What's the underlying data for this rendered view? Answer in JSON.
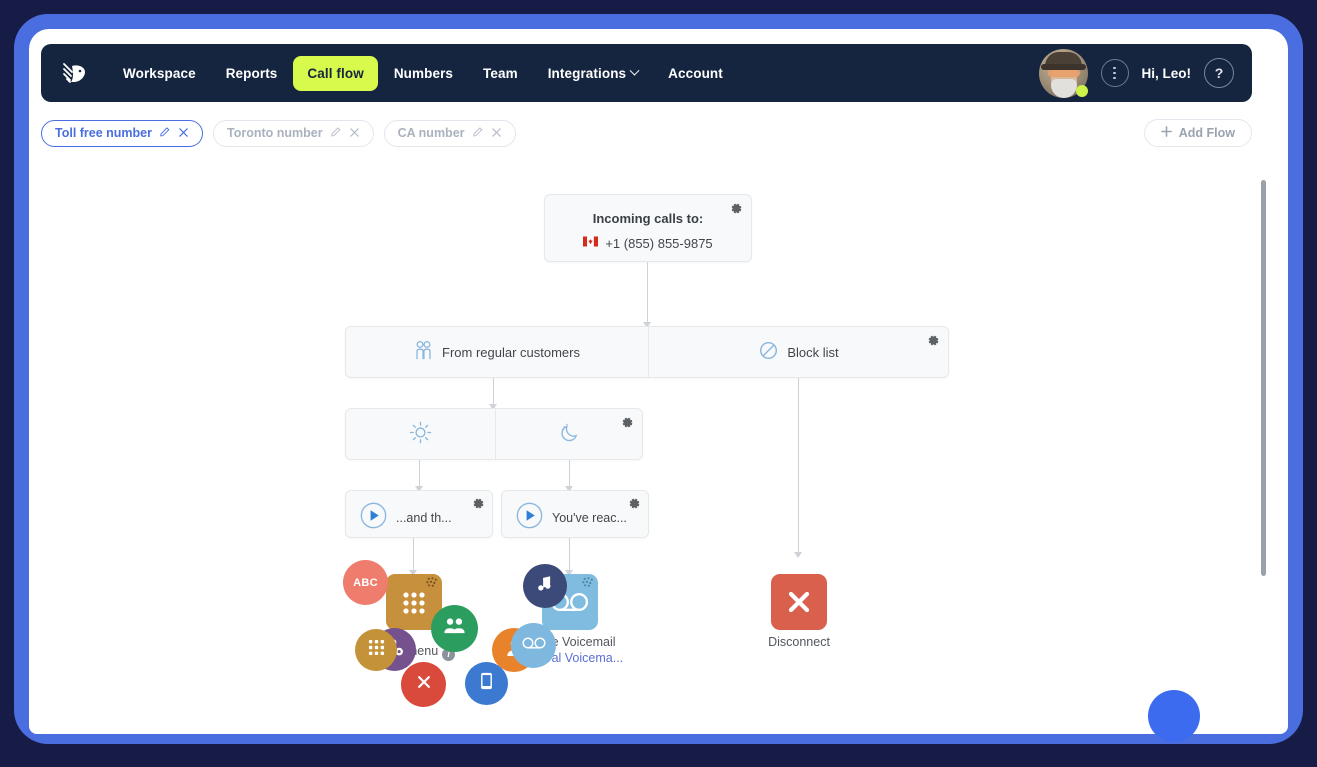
{
  "app": {
    "brand_logo": "lion-head-logo",
    "nav_bg": "#16253f",
    "accent": "#d7fa4c",
    "link_color": "#4a6ee0"
  },
  "nav": {
    "items": [
      {
        "label": "Workspace",
        "active": false,
        "dropdown": false
      },
      {
        "label": "Reports",
        "active": false,
        "dropdown": false
      },
      {
        "label": "Call flow",
        "active": true,
        "dropdown": false
      },
      {
        "label": "Numbers",
        "active": false,
        "dropdown": false
      },
      {
        "label": "Team",
        "active": false,
        "dropdown": false
      },
      {
        "label": "Integrations",
        "active": false,
        "dropdown": true
      },
      {
        "label": "Account",
        "active": false,
        "dropdown": false
      }
    ],
    "greeting": "Hi, Leo!",
    "help_label": "?",
    "more_label": "more-options",
    "status": "online"
  },
  "tabs": {
    "items": [
      {
        "label": "Toll free number",
        "active": true
      },
      {
        "label": "Toronto number",
        "active": false
      },
      {
        "label": "CA number",
        "active": false
      }
    ],
    "edit_icon": "pencil-icon",
    "close_icon": "close-icon",
    "add_flow_label": "Add Flow",
    "add_flow_icon": "plus-icon"
  },
  "flow": {
    "incoming": {
      "title": "Incoming calls to:",
      "number": "+1 (855) 855-9875",
      "flag": "🇨🇦"
    },
    "filter_row": {
      "left": {
        "label": "From regular customers",
        "icon": "two-people-icon"
      },
      "right": {
        "label": "Block list",
        "icon": "block-icon"
      }
    },
    "schedule_row": {
      "left": {
        "label": "Daytime",
        "icon": "sun-icon"
      },
      "right": {
        "label": "Night",
        "icon": "moon-icon"
      }
    },
    "greeting_nodes": {
      "left": {
        "text": "...and th...",
        "icon": "play-icon"
      },
      "right": {
        "text": "You've reac...",
        "icon": "play-icon"
      }
    },
    "leaves": {
      "voice_menu": {
        "label": "Voice menu",
        "icon": "keypad-icon",
        "info": "i"
      },
      "voicemail": {
        "label": "Leave Voicemail",
        "link": "General Voicema...",
        "icon": "voicemail-icon"
      },
      "disconnect": {
        "label": "Disconnect",
        "icon": "x-icon"
      }
    },
    "palette_bubbles": [
      {
        "name": "user-settings-bubble",
        "color": "#75528e",
        "icon": "user-gear-icon"
      },
      {
        "name": "group-bubble",
        "color": "#2b9d5e",
        "icon": "group-icon"
      },
      {
        "name": "single-user-bubble",
        "color": "#e8832c",
        "icon": "user-icon"
      },
      {
        "name": "abc-bubble",
        "color": "#ef7d6e",
        "icon": "ABC"
      },
      {
        "name": "keypad-bubble",
        "color": "#c49239",
        "icon": "keypad-icon"
      },
      {
        "name": "hangup-bubble",
        "color": "#d9493c",
        "icon": "x-icon"
      },
      {
        "name": "mobile-bubble",
        "color": "#3c7ad1",
        "icon": "mobile-icon"
      },
      {
        "name": "music-bubble",
        "color": "#3b4a78",
        "icon": "music-note-icon"
      },
      {
        "name": "voicemail-bubble",
        "color": "#7fb8de",
        "icon": "voicemail-icon"
      }
    ],
    "gear_icon": "gear-icon"
  },
  "chat_widget": {
    "name": "chat-launcher"
  }
}
